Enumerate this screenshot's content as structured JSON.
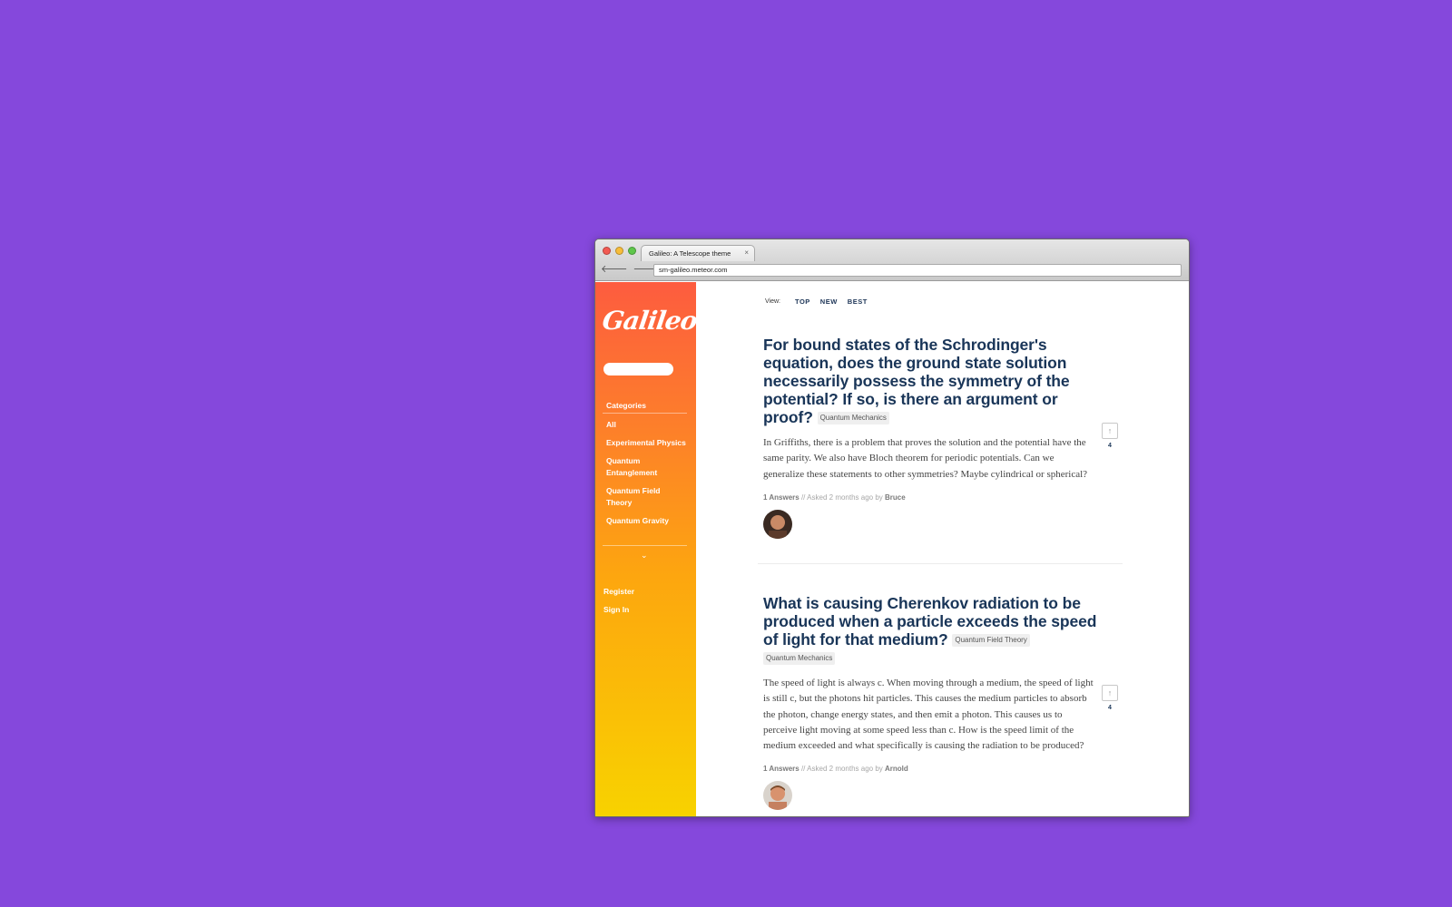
{
  "browser": {
    "tab_title": "Galileo: A Telescope theme",
    "tab_close": "×",
    "url": "sm-galileo.meteor.com",
    "back": "🡐",
    "forward": "🡒",
    "stop": "✕"
  },
  "sidebar": {
    "logo": "Galileo",
    "categories_heading": "Categories",
    "categories": [
      "All",
      "Experimental Physics",
      "Quantum Entanglement",
      "Quantum Field Theory",
      "Quantum Gravity"
    ],
    "more": "⌄",
    "register": "Register",
    "sign_in": "Sign In"
  },
  "view": {
    "label": "View:",
    "options": [
      "TOP",
      "NEW",
      "BEST"
    ]
  },
  "posts": [
    {
      "title": "For bound states of the Schrodinger's equation, does the ground state solution necessarily possess the symmetry of the potential? If so, is there an argument or proof?",
      "tags": [
        "Quantum Mechanics"
      ],
      "body": "In Griffiths, there is a problem that proves the solution and the potential have the same parity. We also have Bloch theorem for periodic potentials. Can we generalize these statements to other symmetries? Maybe cylindrical or spherical?",
      "answers": "1 Answers",
      "asked": " // Asked 2 months ago by ",
      "author": "Bruce",
      "votes": "4",
      "vote_icon": "↑"
    },
    {
      "title": "What is causing Cherenkov radiation to be produced when a particle exceeds the speed of light for that medium?",
      "tags": [
        "Quantum Field Theory",
        "Quantum Mechanics"
      ],
      "body": "The speed of light is always c. When moving through a medium, the speed of light is still c, but the photons hit particles. This causes the medium particles to absorb the photon, change energy states, and then emit a photon. This causes us to perceive light moving at some speed less than c. How is the speed limit of the medium exceeded and what specifically is causing the radiation to be produced?",
      "answers": "1 Answers",
      "asked": " // Asked 2 months ago by ",
      "author": "Arnold",
      "votes": "4",
      "vote_icon": "↑"
    }
  ]
}
